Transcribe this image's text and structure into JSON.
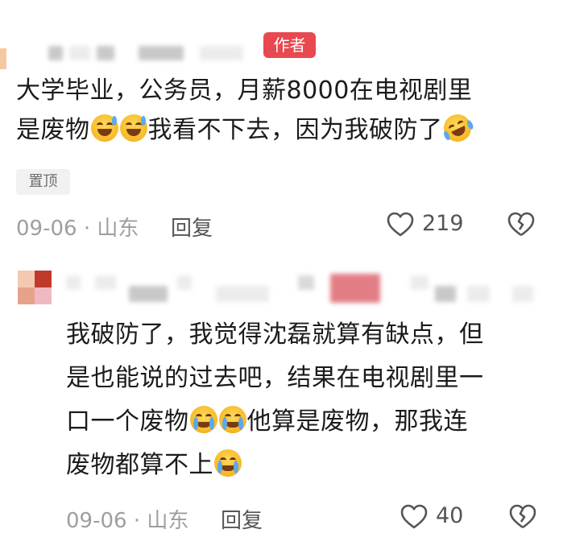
{
  "comment1": {
    "author_badge": "作者",
    "text_line1": "大学毕业，公务员，月薪8000在电视剧里",
    "text_line2_a": "是废物",
    "text_line2_b": "我看不下去，因为我破防了",
    "pin_label": "置顶",
    "date_location": "09-06 · 山东",
    "reply_label": "回复",
    "like_count": "219"
  },
  "comment2": {
    "line1": "我破防了，我觉得沈磊就算有缺点，但",
    "line2": "是也能说的过去吧，结果在电视剧里一",
    "line3_a": "口一个废物",
    "line3_b": "他算是废物，那我连",
    "line4": "废物都算不上",
    "date_location": "09-06 · 山东",
    "reply_label": "回复",
    "like_count": "40"
  },
  "icons": {
    "like": "heart-outline-icon",
    "dislike": "broken-heart-icon",
    "emoji_sweat_smile": "grinning-sweat-emoji",
    "emoji_laugh_cry": "rolling-laughing-emoji",
    "emoji_cry": "loudly-crying-emoji"
  },
  "colors": {
    "author_badge": "#e8484f",
    "meta_text": "#9e9e9e"
  }
}
